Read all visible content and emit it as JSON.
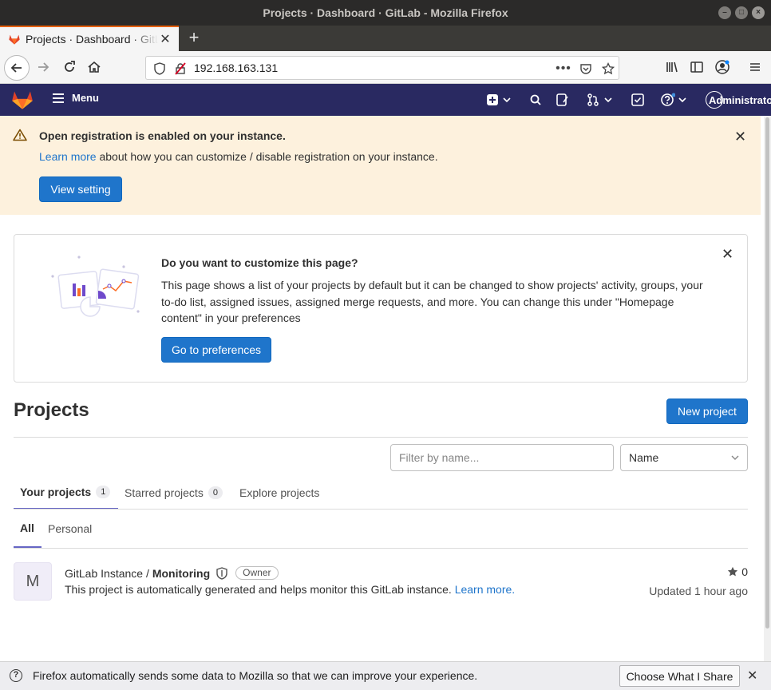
{
  "window": {
    "title": "Projects · Dashboard · GitLab - Mozilla Firefox"
  },
  "browser": {
    "tab_title": "Projects · Dashboard · GitLab",
    "url": "192.168.163.131",
    "brand_color": "#e66000"
  },
  "gitlab_header": {
    "menu_label": "Menu",
    "user_label": "Administrator",
    "bg_color": "#292961"
  },
  "registration_alert": {
    "title": "Open registration is enabled on your instance.",
    "link_text": "Learn more",
    "text_rest": " about how you can customize / disable registration on your instance.",
    "button_label": "View setting",
    "bg_color": "#fdf1dd"
  },
  "customize_card": {
    "title": "Do you want to customize this page?",
    "text": "This page shows a list of your projects by default but it can be changed to show projects' activity, groups, your to-do list, assigned issues, assigned merge requests, and more. You can change this under \"Homepage content\" in your preferences",
    "button_label": "Go to preferences"
  },
  "projects": {
    "title": "Projects",
    "new_button_label": "New project",
    "filter_placeholder": "Filter by name...",
    "sort_value": "Name",
    "tabs": [
      {
        "label": "Your projects",
        "count": "1"
      },
      {
        "label": "Starred projects",
        "count": "0"
      },
      {
        "label": "Explore projects"
      }
    ],
    "subtabs": [
      {
        "label": "All"
      },
      {
        "label": "Personal"
      }
    ],
    "items": [
      {
        "avatar_letter": "M",
        "namespace": "GitLab Instance /",
        "name": "Monitoring",
        "role": "Owner",
        "description": "This project is automatically generated and helps monitor this GitLab instance.",
        "description_link": "Learn more.",
        "stars": "0",
        "updated": "Updated 1 hour ago"
      }
    ]
  },
  "notification": {
    "text": "Firefox automatically sends some data to Mozilla so that we can improve your experience.",
    "button_label": "Choose What I Share"
  },
  "colors": {
    "primary_button": "#1f75cb",
    "active_tab_underline": "#6666c4"
  }
}
